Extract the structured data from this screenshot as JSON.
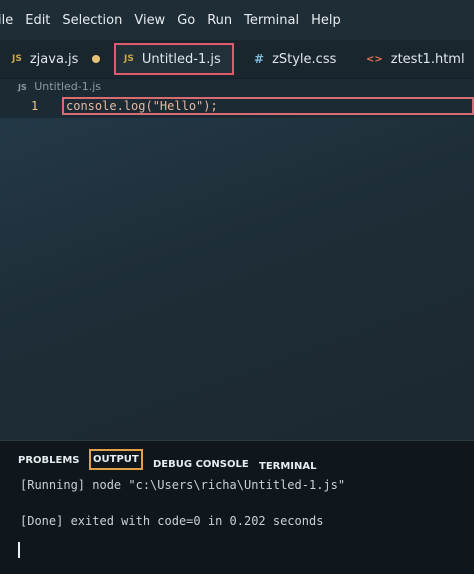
{
  "menubar": {
    "items": [
      "ile",
      "Edit",
      "Selection",
      "View",
      "Go",
      "Run",
      "Terminal",
      "Help"
    ]
  },
  "tabs": [
    {
      "icon": "JS",
      "label": "zjava.js",
      "modified": true
    },
    {
      "icon": "JS",
      "label": "Untitled-1.js",
      "modified": true,
      "active": true
    },
    {
      "icon": "#",
      "label": "zStyle.css",
      "modified": false
    },
    {
      "icon": "<>",
      "label": "ztest1.html",
      "modified": false
    }
  ],
  "breadcrumb": {
    "icon": "JS",
    "label": "Untitled-1.js"
  },
  "editor": {
    "line_number": "1",
    "code": "console.log(\"Hello\");"
  },
  "panel": {
    "tabs": [
      "PROBLEMS",
      "OUTPUT",
      "DEBUG CONSOLE",
      "TERMINAL"
    ],
    "active_tab": "OUTPUT",
    "output": [
      "[Running] node \"c:\\Users\\richa\\Untitled-1.js\"",
      "[Done] exited with code=0 in 0.202 seconds"
    ]
  },
  "colors": {
    "accent_highlight": "#e0596c",
    "active_panel_tab_outline": "#e0a14a",
    "modified_dot": "#e8c275"
  }
}
